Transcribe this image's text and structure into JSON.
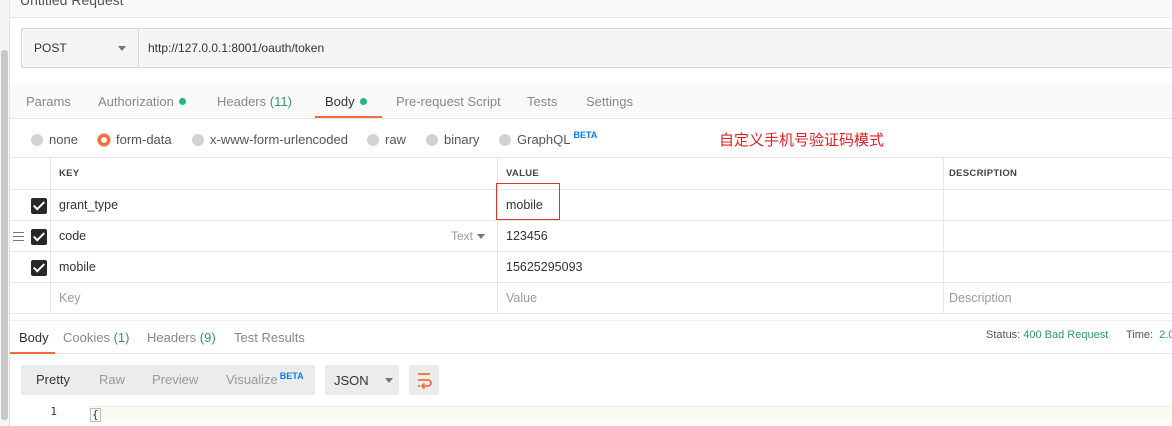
{
  "window": {
    "title": "Untitled Request"
  },
  "request": {
    "method": "POST",
    "url": "http://127.0.0.1:8001/oauth/token"
  },
  "request_tabs": [
    {
      "label": "Params"
    },
    {
      "label": "Authorization",
      "dot": true
    },
    {
      "label": "Headers",
      "count": "(11)"
    },
    {
      "label": "Body",
      "dot": true,
      "active": true
    },
    {
      "label": "Pre-request Script"
    },
    {
      "label": "Tests"
    },
    {
      "label": "Settings"
    }
  ],
  "body_types": [
    {
      "label": "none"
    },
    {
      "label": "form-data",
      "selected": true
    },
    {
      "label": "x-www-form-urlencoded"
    },
    {
      "label": "raw"
    },
    {
      "label": "binary"
    },
    {
      "label": "GraphQL",
      "badge": "BETA"
    }
  ],
  "annotation": "自定义手机号验证码模式",
  "form_table": {
    "headers": {
      "key": "KEY",
      "value": "VALUE",
      "description": "DESCRIPTION"
    },
    "rows": [
      {
        "key": "grant_type",
        "value": "mobile",
        "description": ""
      },
      {
        "key": "code",
        "value": "123456",
        "description": "",
        "type_label": "Text"
      },
      {
        "key": "mobile",
        "value": "15625295093",
        "description": ""
      }
    ],
    "placeholders": {
      "key": "Key",
      "value": "Value",
      "description": "Description"
    }
  },
  "response_tabs": [
    {
      "label": "Body",
      "active": true
    },
    {
      "label": "Cookies",
      "count": "(1)"
    },
    {
      "label": "Headers",
      "count": "(9)"
    },
    {
      "label": "Test Results"
    }
  ],
  "response_status": {
    "status_label": "Status:",
    "status_value": "400 Bad Request",
    "time_label": "Time:",
    "time_value": "2.0"
  },
  "response_view": {
    "modes": [
      "Pretty",
      "Raw",
      "Preview",
      "Visualize"
    ],
    "visualize_badge": "BETA",
    "format": "JSON",
    "wrap_icon": "wrap-lines-icon"
  },
  "editor": {
    "line_numbers": [
      "1"
    ],
    "first_line": "{"
  },
  "colors": {
    "accent": "#f26b3a",
    "success": "#2d9d63",
    "annotation": "#e02020",
    "beta": "#097bed"
  }
}
